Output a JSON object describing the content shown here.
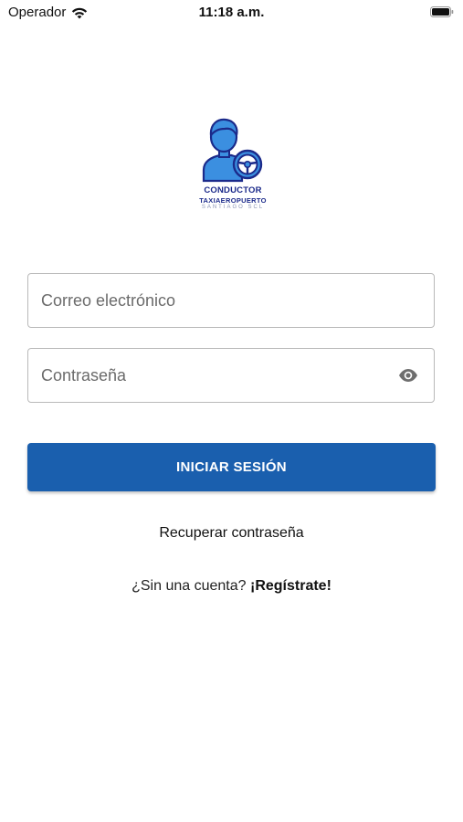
{
  "status_bar": {
    "carrier": "Operador",
    "time": "11:18 a.m."
  },
  "logo": {
    "title": "CONDUCTOR",
    "subtitle": "TAXIAEROPUERTO",
    "tagline": "SANTIAGO SCL"
  },
  "form": {
    "email": {
      "placeholder": "Correo electrónico",
      "value": ""
    },
    "password": {
      "placeholder": "Contraseña",
      "value": ""
    },
    "submit_label": "INICIAR SESIÓN"
  },
  "links": {
    "recover": "Recuperar contraseña",
    "signup_prompt": "¿Sin una cuenta?",
    "signup": "¡Regístrate!"
  },
  "colors": {
    "primary": "#1a5fae",
    "logo_blue": "#3b8fe0",
    "logo_text": "#1b2a8a"
  }
}
